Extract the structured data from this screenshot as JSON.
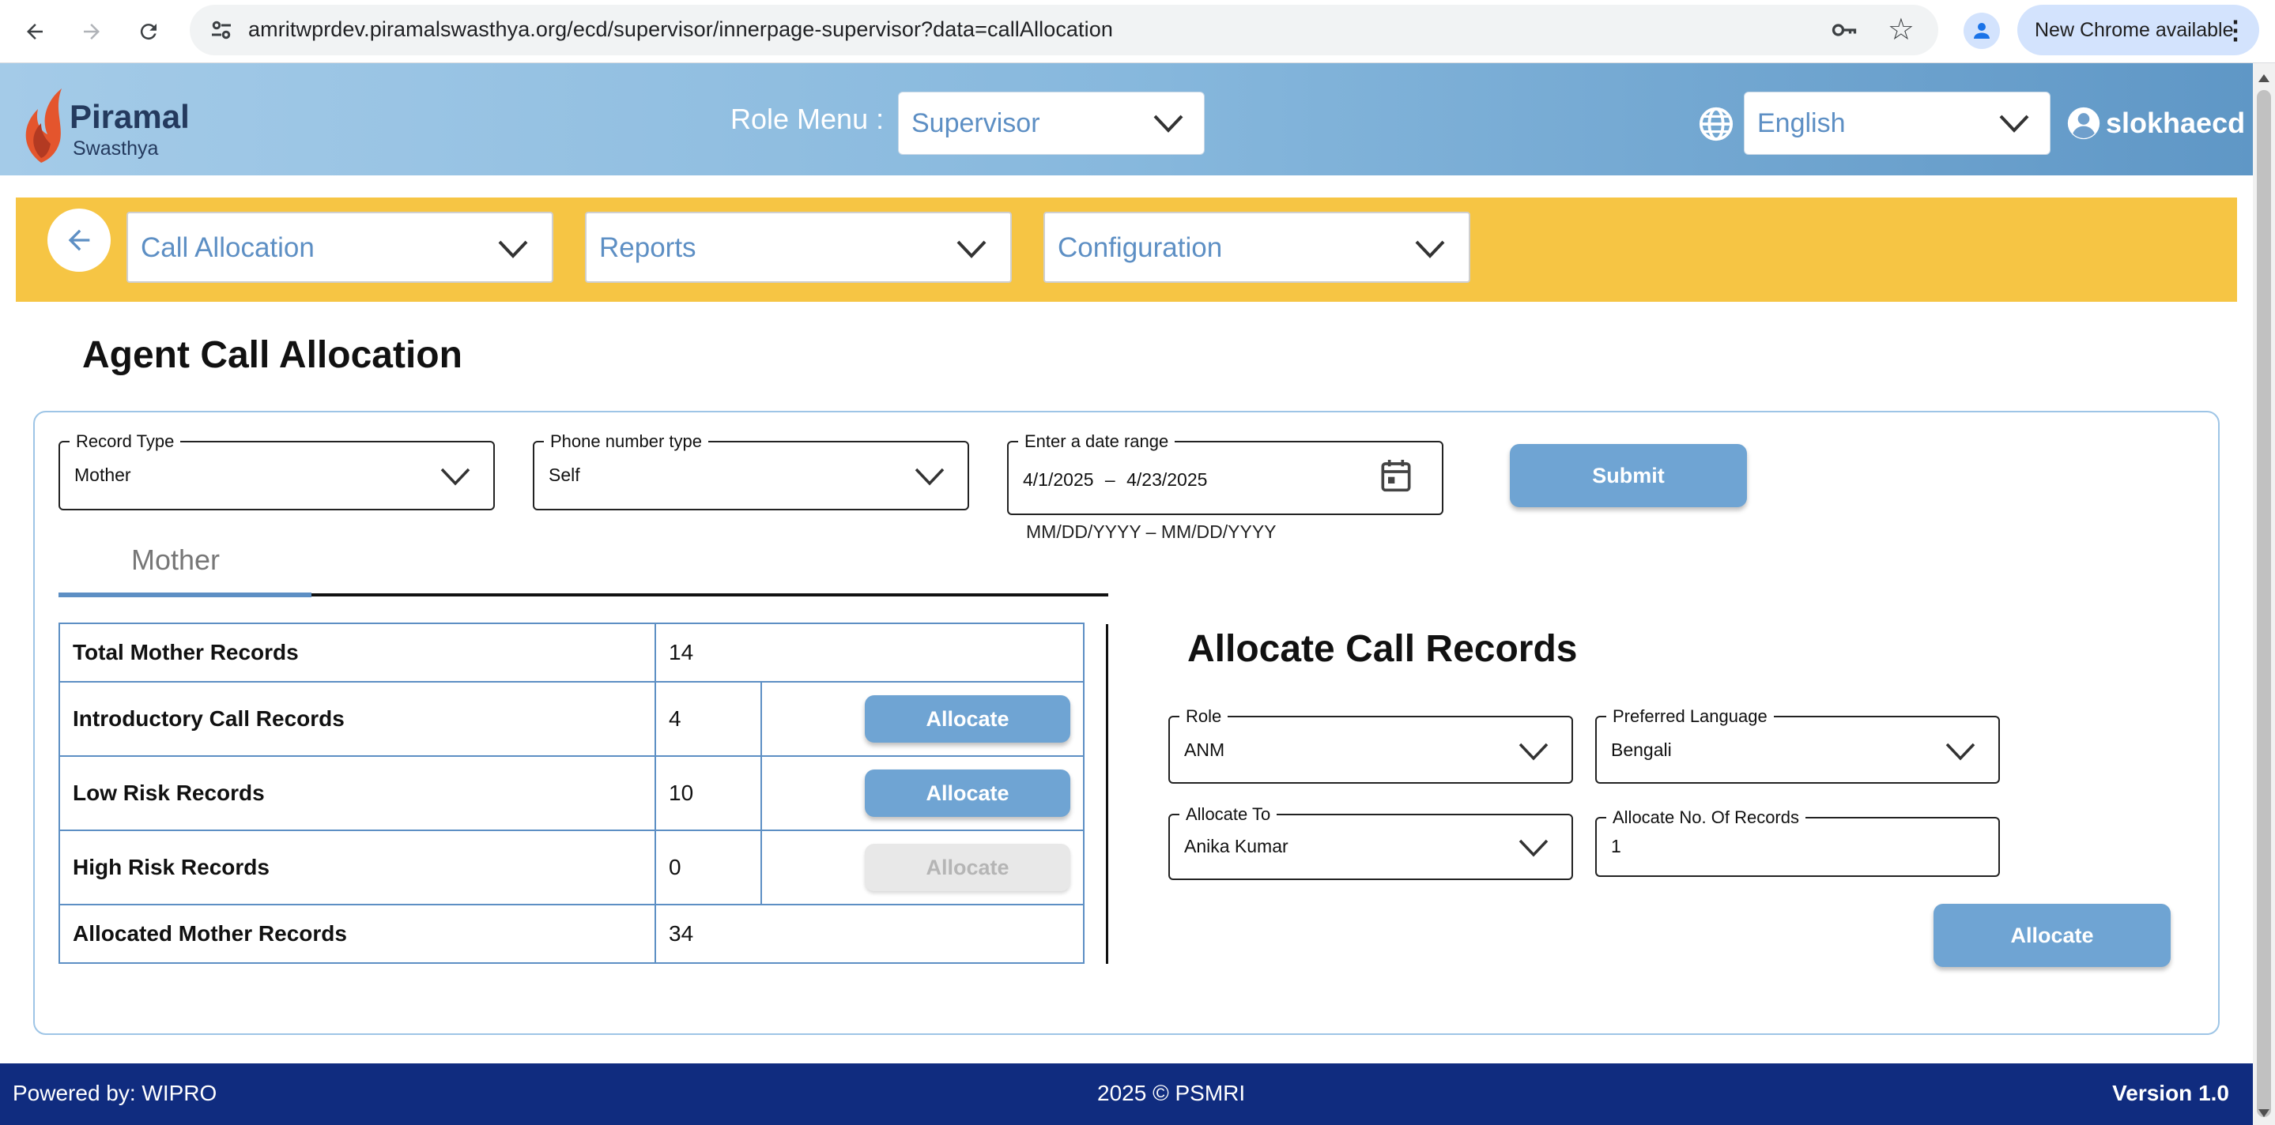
{
  "browser": {
    "url": "amritwprdev.piramalswasthya.org/ecd/supervisor/innerpage-supervisor?data=callAllocation",
    "update_label": "New Chrome available"
  },
  "header": {
    "brand": "Piramal",
    "brand_sub": "Swasthya",
    "role_menu_label": "Role Menu :",
    "role_value": "Supervisor",
    "language_value": "English",
    "username": "slokhaecd"
  },
  "menubar": {
    "items": [
      {
        "label": "Call Allocation"
      },
      {
        "label": "Reports"
      },
      {
        "label": "Configuration"
      }
    ]
  },
  "page": {
    "title": "Agent Call Allocation"
  },
  "filters": {
    "record_type_label": "Record Type",
    "record_type_value": "Mother",
    "phone_type_label": "Phone number type",
    "phone_type_value": "Self",
    "date_range_label": "Enter a date range",
    "date_start": "4/1/2025",
    "date_sep": "–",
    "date_end": "4/23/2025",
    "date_hint": "MM/DD/YYYY – MM/DD/YYYY",
    "submit_label": "Submit"
  },
  "tabs": {
    "active": "Mother"
  },
  "stats": {
    "rows": [
      {
        "label": "Total Mother Records",
        "value": "14"
      },
      {
        "label": "Introductory Call Records",
        "value": "4",
        "action": "Allocate"
      },
      {
        "label": "Low Risk Records",
        "value": "10",
        "action": "Allocate"
      },
      {
        "label": "High Risk Records",
        "value": "0",
        "action": "Allocate"
      },
      {
        "label": "Allocated Mother Records",
        "value": "34"
      }
    ]
  },
  "allocate": {
    "title": "Allocate Call Records",
    "role_label": "Role",
    "role_value": "ANM",
    "language_label": "Preferred Language",
    "language_value": "Bengali",
    "allocate_to_label": "Allocate To",
    "allocate_to_value": "Anika Kumar",
    "count_label": "Allocate No. Of Records",
    "count_value": "1",
    "button_label": "Allocate"
  },
  "footer": {
    "left": "Powered by: WIPRO",
    "center": "2025 © PSMRI",
    "right": "Version 1.0"
  },
  "colors": {
    "accent": "#5d8fc4",
    "button": "#6fa4d3",
    "menubar": "#f6c544",
    "footer": "#102c7f"
  }
}
